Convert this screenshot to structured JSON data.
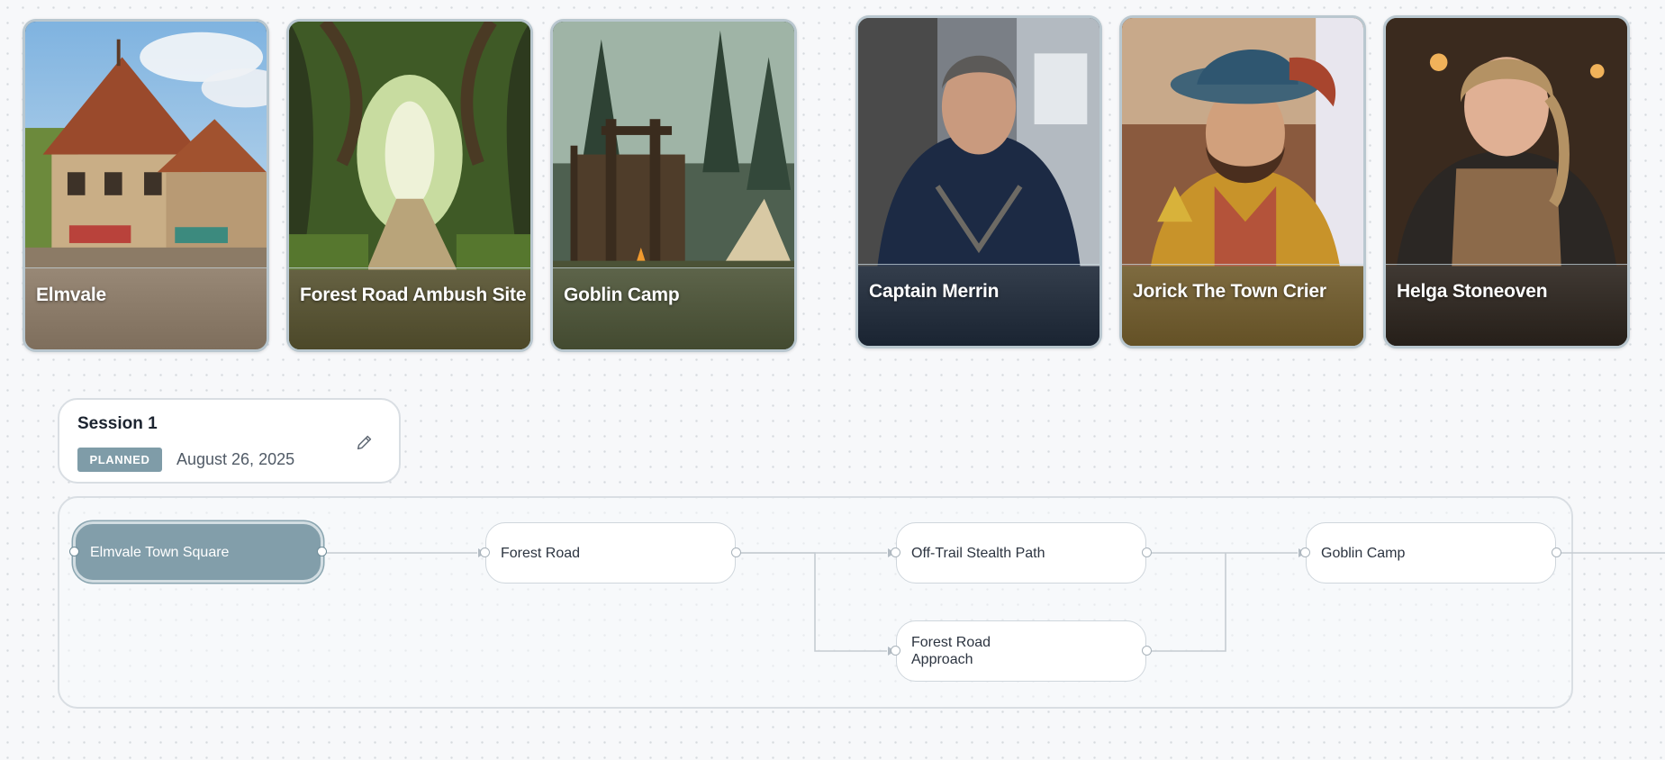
{
  "location_cards": [
    {
      "label": "Elmvale"
    },
    {
      "label": "Forest Road Ambush Site"
    },
    {
      "label": "Goblin Camp"
    }
  ],
  "character_cards": [
    {
      "label": "Captain Merrin"
    },
    {
      "label": "Jorick The Town Crier"
    },
    {
      "label": "Helga Stoneoven"
    }
  ],
  "session": {
    "title": "Session 1",
    "status": "PLANNED",
    "date": "August 26, 2025"
  },
  "flow": {
    "nodes": [
      {
        "label": "Elmvale Town Square",
        "active": true
      },
      {
        "label": "Forest Road",
        "active": false
      },
      {
        "label": "Off-Trail Stealth Path",
        "active": false
      },
      {
        "label": "Forest Road Approach",
        "active": false
      },
      {
        "label": "Goblin Camp",
        "active": false
      }
    ]
  },
  "colors": {
    "accent": "#829eaa",
    "badge": "#7f9ca8",
    "card_border": "#b9c7cf"
  }
}
